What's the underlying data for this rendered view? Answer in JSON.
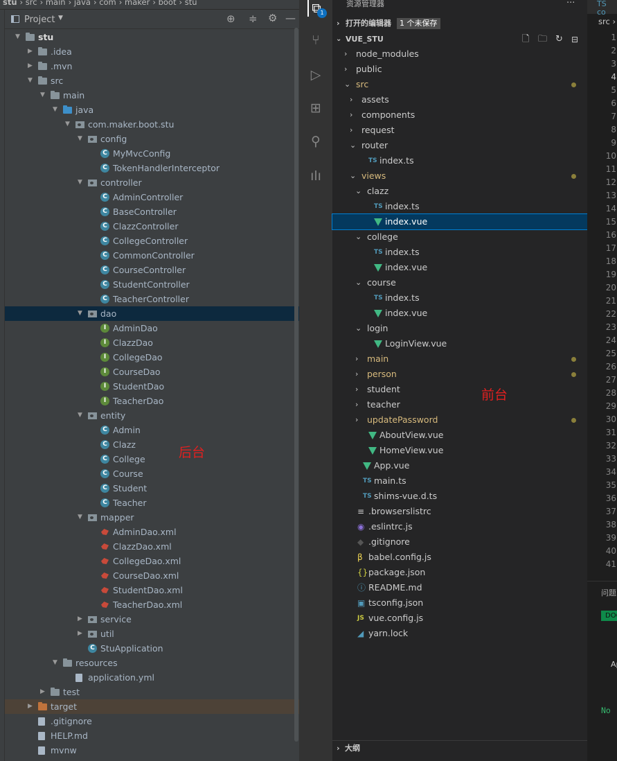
{
  "breadcrumb": [
    "stu",
    "src",
    "main",
    "java",
    "com",
    "maker",
    "boot",
    "stu"
  ],
  "project_panel": {
    "title": "Project"
  },
  "left_tree": [
    {
      "label": "stu",
      "depth": 0,
      "kind": "folder",
      "arrow": "open",
      "bold": true
    },
    {
      "label": ".idea",
      "depth": 1,
      "kind": "folder",
      "arrow": "closed"
    },
    {
      "label": ".mvn",
      "depth": 1,
      "kind": "folder",
      "arrow": "closed"
    },
    {
      "label": "src",
      "depth": 1,
      "kind": "folder",
      "arrow": "open"
    },
    {
      "label": "main",
      "depth": 2,
      "kind": "folder",
      "arrow": "open"
    },
    {
      "label": "java",
      "depth": 3,
      "kind": "folder-blue",
      "arrow": "open"
    },
    {
      "label": "com.maker.boot.stu",
      "depth": 4,
      "kind": "package",
      "arrow": "open"
    },
    {
      "label": "config",
      "depth": 5,
      "kind": "package",
      "arrow": "open"
    },
    {
      "label": "MyMvcConfig",
      "depth": 6,
      "kind": "class"
    },
    {
      "label": "TokenHandlerInterceptor",
      "depth": 6,
      "kind": "class"
    },
    {
      "label": "controller",
      "depth": 5,
      "kind": "package",
      "arrow": "open"
    },
    {
      "label": "AdminController",
      "depth": 6,
      "kind": "class"
    },
    {
      "label": "BaseController",
      "depth": 6,
      "kind": "class"
    },
    {
      "label": "ClazzController",
      "depth": 6,
      "kind": "class"
    },
    {
      "label": "CollegeController",
      "depth": 6,
      "kind": "class"
    },
    {
      "label": "CommonController",
      "depth": 6,
      "kind": "class"
    },
    {
      "label": "CourseController",
      "depth": 6,
      "kind": "class"
    },
    {
      "label": "StudentController",
      "depth": 6,
      "kind": "class"
    },
    {
      "label": "TeacherController",
      "depth": 6,
      "kind": "class"
    },
    {
      "label": "dao",
      "depth": 5,
      "kind": "package",
      "arrow": "open",
      "selected": true
    },
    {
      "label": "AdminDao",
      "depth": 6,
      "kind": "interface"
    },
    {
      "label": "ClazzDao",
      "depth": 6,
      "kind": "interface"
    },
    {
      "label": "CollegeDao",
      "depth": 6,
      "kind": "interface"
    },
    {
      "label": "CourseDao",
      "depth": 6,
      "kind": "interface"
    },
    {
      "label": "StudentDao",
      "depth": 6,
      "kind": "interface"
    },
    {
      "label": "TeacherDao",
      "depth": 6,
      "kind": "interface"
    },
    {
      "label": "entity",
      "depth": 5,
      "kind": "package",
      "arrow": "open"
    },
    {
      "label": "Admin",
      "depth": 6,
      "kind": "class"
    },
    {
      "label": "Clazz",
      "depth": 6,
      "kind": "class"
    },
    {
      "label": "College",
      "depth": 6,
      "kind": "class"
    },
    {
      "label": "Course",
      "depth": 6,
      "kind": "class"
    },
    {
      "label": "Student",
      "depth": 6,
      "kind": "class"
    },
    {
      "label": "Teacher",
      "depth": 6,
      "kind": "class"
    },
    {
      "label": "mapper",
      "depth": 5,
      "kind": "package",
      "arrow": "open"
    },
    {
      "label": "AdminDao.xml",
      "depth": 6,
      "kind": "xml"
    },
    {
      "label": "ClazzDao.xml",
      "depth": 6,
      "kind": "xml"
    },
    {
      "label": "CollegeDao.xml",
      "depth": 6,
      "kind": "xml"
    },
    {
      "label": "CourseDao.xml",
      "depth": 6,
      "kind": "xml"
    },
    {
      "label": "StudentDao.xml",
      "depth": 6,
      "kind": "xml"
    },
    {
      "label": "TeacherDao.xml",
      "depth": 6,
      "kind": "xml"
    },
    {
      "label": "service",
      "depth": 5,
      "kind": "package",
      "arrow": "closed"
    },
    {
      "label": "util",
      "depth": 5,
      "kind": "package",
      "arrow": "closed"
    },
    {
      "label": "StuApplication",
      "depth": 5,
      "kind": "class"
    },
    {
      "label": "resources",
      "depth": 3,
      "kind": "folder",
      "arrow": "open"
    },
    {
      "label": "application.yml",
      "depth": 4,
      "kind": "file"
    },
    {
      "label": "test",
      "depth": 2,
      "kind": "folder",
      "arrow": "closed"
    },
    {
      "label": "target",
      "depth": 1,
      "kind": "folder-orange",
      "arrow": "closed",
      "target": true
    },
    {
      "label": ".gitignore",
      "depth": 1,
      "kind": "file"
    },
    {
      "label": "HELP.md",
      "depth": 1,
      "kind": "file"
    },
    {
      "label": "mvnw",
      "depth": 1,
      "kind": "file"
    }
  ],
  "annotation_left": "后台",
  "annotation_right": "前台",
  "activity_badge": "1",
  "explorer": {
    "title": "资源管理器",
    "open_editors": "打开的编辑器",
    "unsaved": "1 个未保存",
    "project": "VUE_STU",
    "outline": "大纲"
  },
  "explorer_tree": [
    {
      "label": "node_modules",
      "indent": 0,
      "chev": "closed"
    },
    {
      "label": "public",
      "indent": 0,
      "chev": "closed"
    },
    {
      "label": "src",
      "indent": 0,
      "chev": "open",
      "mod": true,
      "dot": true
    },
    {
      "label": "assets",
      "indent": 1,
      "chev": "closed"
    },
    {
      "label": "components",
      "indent": 1,
      "chev": "closed"
    },
    {
      "label": "request",
      "indent": 1,
      "chev": "closed"
    },
    {
      "label": "router",
      "indent": 1,
      "chev": "open"
    },
    {
      "label": "index.ts",
      "indent": 2,
      "icon": "ts"
    },
    {
      "label": "views",
      "indent": 1,
      "chev": "open",
      "mod": true,
      "dot": true
    },
    {
      "label": "clazz",
      "indent": 2,
      "chev": "open"
    },
    {
      "label": "index.ts",
      "indent": 3,
      "icon": "ts"
    },
    {
      "label": "index.vue",
      "indent": 3,
      "icon": "vue",
      "selected": true
    },
    {
      "label": "college",
      "indent": 2,
      "chev": "open"
    },
    {
      "label": "index.ts",
      "indent": 3,
      "icon": "ts"
    },
    {
      "label": "index.vue",
      "indent": 3,
      "icon": "vue"
    },
    {
      "label": "course",
      "indent": 2,
      "chev": "open"
    },
    {
      "label": "index.ts",
      "indent": 3,
      "icon": "ts"
    },
    {
      "label": "index.vue",
      "indent": 3,
      "icon": "vue"
    },
    {
      "label": "login",
      "indent": 2,
      "chev": "open"
    },
    {
      "label": "LoginView.vue",
      "indent": 3,
      "icon": "vue"
    },
    {
      "label": "main",
      "indent": 2,
      "chev": "closed",
      "mod": true,
      "dot": true
    },
    {
      "label": "person",
      "indent": 2,
      "chev": "closed",
      "mod": true,
      "dot": true
    },
    {
      "label": "student",
      "indent": 2,
      "chev": "closed"
    },
    {
      "label": "teacher",
      "indent": 2,
      "chev": "closed"
    },
    {
      "label": "updatePassword",
      "indent": 2,
      "chev": "closed",
      "mod": true,
      "dot": true
    },
    {
      "label": "AboutView.vue",
      "indent": 2,
      "icon": "vue"
    },
    {
      "label": "HomeView.vue",
      "indent": 2,
      "icon": "vue"
    },
    {
      "label": "App.vue",
      "indent": 1,
      "icon": "vue"
    },
    {
      "label": "main.ts",
      "indent": 1,
      "icon": "ts"
    },
    {
      "label": "shims-vue.d.ts",
      "indent": 1,
      "icon": "ts"
    },
    {
      "label": ".browserslistrc",
      "indent": 0,
      "icon": "lines"
    },
    {
      "label": ".eslintrc.js",
      "indent": 0,
      "icon": "eslint"
    },
    {
      "label": ".gitignore",
      "indent": 0,
      "icon": "git"
    },
    {
      "label": "babel.config.js",
      "indent": 0,
      "icon": "babel"
    },
    {
      "label": "package.json",
      "indent": 0,
      "icon": "json"
    },
    {
      "label": "README.md",
      "indent": 0,
      "icon": "info"
    },
    {
      "label": "tsconfig.json",
      "indent": 0,
      "icon": "tsconfig"
    },
    {
      "label": "vue.config.js",
      "indent": 0,
      "icon": "js"
    },
    {
      "label": "yarn.lock",
      "indent": 0,
      "icon": "yarn"
    }
  ],
  "line_numbers": [
    1,
    2,
    3,
    4,
    5,
    6,
    7,
    8,
    9,
    10,
    11,
    12,
    13,
    14,
    15,
    16,
    17,
    18,
    19,
    20,
    21,
    22,
    23,
    24,
    25,
    26,
    27,
    28,
    29,
    30,
    31,
    32,
    33,
    34,
    35,
    36,
    37,
    38,
    39,
    40,
    41
  ],
  "right": {
    "tab": "TS co",
    "src": "src ›",
    "panel_tab": "问题",
    "doc": "DOC",
    "ap": "Ap",
    "no_line": "No"
  }
}
